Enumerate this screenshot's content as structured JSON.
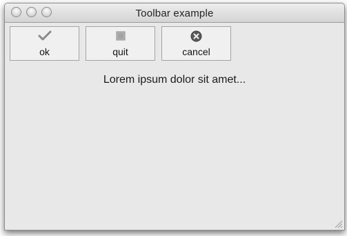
{
  "window": {
    "title": "Toolbar example"
  },
  "toolbar": {
    "buttons": [
      {
        "label": "ok",
        "icon": "checkmark-icon"
      },
      {
        "label": "quit",
        "icon": "stop-icon"
      },
      {
        "label": "cancel",
        "icon": "cancel-circle-icon"
      }
    ]
  },
  "content": {
    "text": "Lorem ipsum dolor sit amet..."
  }
}
